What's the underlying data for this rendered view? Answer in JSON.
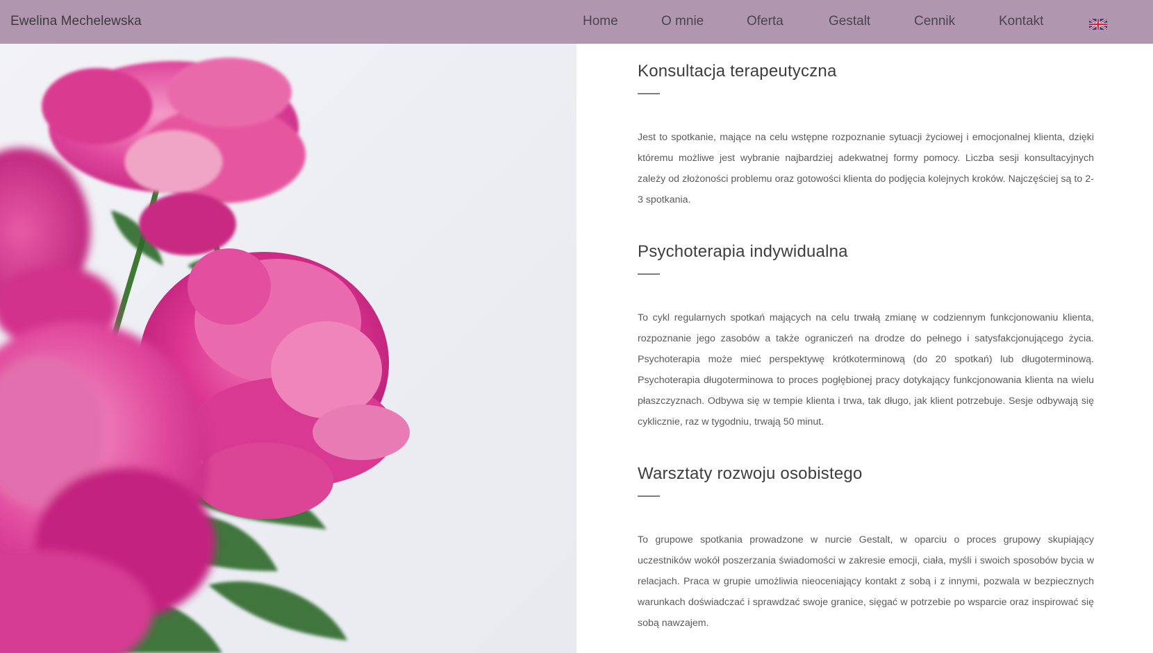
{
  "header": {
    "brand": "Ewelina Mechelewska",
    "nav": [
      {
        "label": "Home"
      },
      {
        "label": "O mnie"
      },
      {
        "label": "Oferta"
      },
      {
        "label": "Gestalt"
      },
      {
        "label": "Cennik"
      },
      {
        "label": "Kontakt"
      }
    ],
    "language_icon": "uk-flag-icon"
  },
  "hero": {
    "image": "pink-peonies-photo"
  },
  "sections": [
    {
      "title": "Konsultacja terapeutyczna",
      "text": "Jest to spotkanie, mające na celu wstępne rozpoznanie sytuacji życiowej i emocjonalnej klienta, dzięki któremu możliwe jest wybranie najbardziej adekwatnej formy pomocy. Liczba sesji konsultacyjnych zależy od złożoności problemu oraz gotowości klienta do podjęcia kolejnych kroków. Najczęściej są to 2-3 spotkania."
    },
    {
      "title": "Psychoterapia indywidualna",
      "text": "To cykl regularnych spotkań mających na celu trwałą zmianę w codziennym funkcjonowaniu klienta, rozpoznanie jego zasobów a także ograniczeń na drodze do pełnego i satysfakcjonującego życia. Psychoterapia może mieć perspektywę krótkoterminową (do 20 spotkań) lub długoterminową. Psychoterapia długoterminowa to proces pogłębionej pracy dotykający funkcjonowania klienta na wielu płaszczyznach. Odbywa się w tempie klienta i trwa, tak długo, jak klient potrzebuje. Sesje odbywają się cyklicznie, raz w tygodniu, trwają 50 minut."
    },
    {
      "title": "Warsztaty rozwoju osobistego",
      "text": "To grupowe spotkania prowadzone w nurcie Gestalt, w oparciu o proces grupowy skupiający uczestników wokół poszerzania świadomości w zakresie emocji, ciała, myśli i swoich sposobów bycia w relacjach. Praca w grupie umożliwia nieoceniający kontakt z sobą i z innymi, pozwala w bezpiecznych warunkach doświadczać i sprawdzać swoje granice, sięgać w potrzebie po wsparcie oraz inspirować się sobą nawzajem."
    }
  ],
  "colors": {
    "header_bg": "#b196b0",
    "peony": "#d9318f"
  }
}
